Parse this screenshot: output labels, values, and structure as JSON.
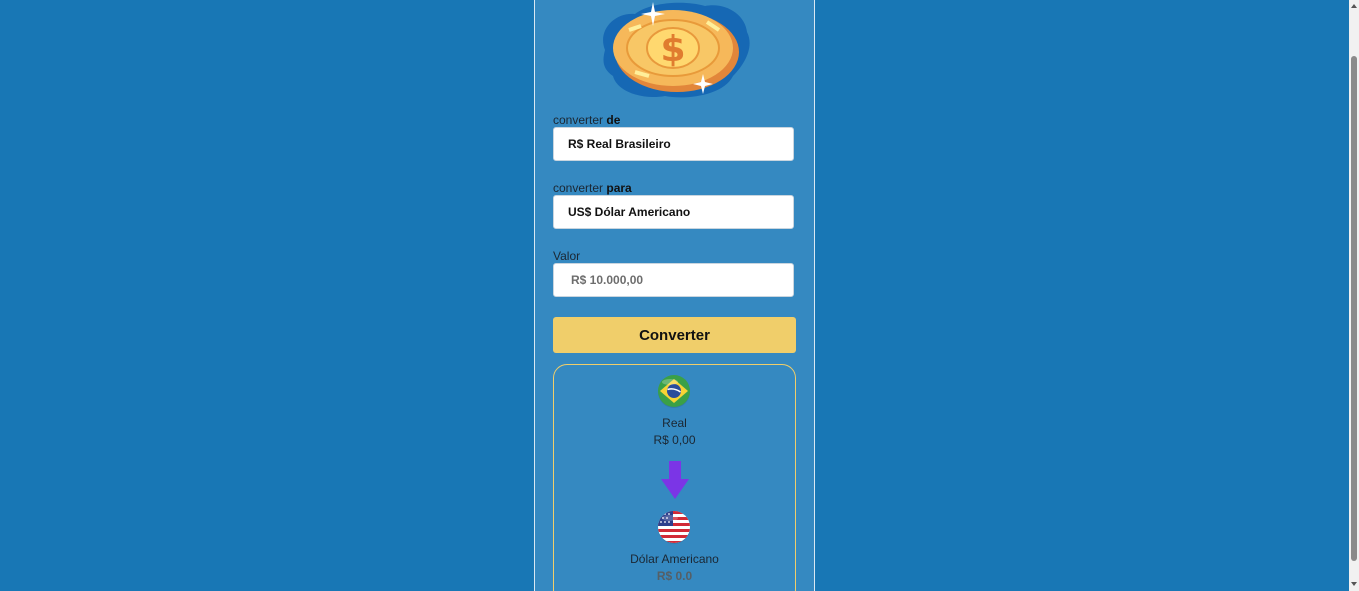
{
  "form": {
    "from_label_prefix": "converter",
    "from_label_bold": "de",
    "from_value": "R$ Real Brasileiro",
    "to_label_prefix": "converter",
    "to_label_bold": "para",
    "to_value": "US$ Dólar Americano",
    "amount_label": "Valor",
    "amount_placeholder": "R$ 10.000,00",
    "convert_button": "Converter"
  },
  "result": {
    "from_currency": "Real",
    "from_amount": "R$ 0,00",
    "to_currency": "Dólar Americano",
    "to_amount": "R$ 0.0"
  },
  "icons": {
    "logo": "coin-dollar-icon",
    "from_flag": "brazil-flag-icon",
    "to_flag": "usa-flag-icon",
    "arrow": "arrow-down-icon"
  },
  "colors": {
    "background": "#1877b5",
    "panel": "#3589c1",
    "button": "#f0ce6a",
    "arrow": "#7b35e6"
  }
}
